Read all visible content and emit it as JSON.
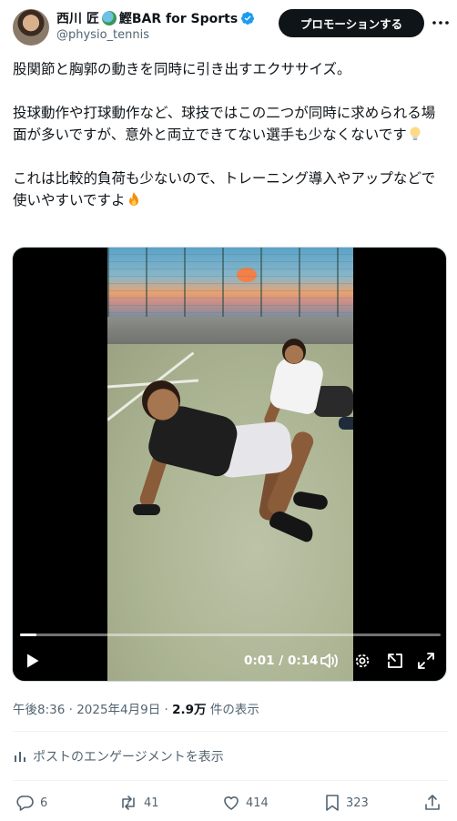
{
  "author": {
    "display_name": "西川 匠",
    "display_name_suffix": "鰹BAR for Sports",
    "handle": "@physio_tennis",
    "verified": true
  },
  "header": {
    "promote_label": "プロモーションする",
    "more_icon": "more-icon"
  },
  "tweet": {
    "paragraph1": "股関節と胸郭の動きを同時に引き出すエクササイズ。",
    "paragraph2": "投球動作や打球動作など、球技ではこの二つが同時に求められる場面が多いですが、意外と両立できてない選手も少なくないです",
    "paragraph3": "これは比較的負荷も少ないので、トレーニング導入やアップなどで使いやすいですよ",
    "emoji1": "lightbulb-icon",
    "emoji2": "fire-icon"
  },
  "video": {
    "current_time": "0:01",
    "separator": " / ",
    "duration": "0:14",
    "progress": 0.04
  },
  "meta": {
    "time": "午後8:36",
    "dot": " · ",
    "date": "2025年4月9日",
    "views": "2.9万",
    "views_label": " 件の表示"
  },
  "engagement_link": "ポストのエンゲージメントを表示",
  "actions": {
    "replies": "6",
    "retweets": "41",
    "likes": "414",
    "bookmarks": "323"
  },
  "colors": {
    "text_primary": "#0f1419",
    "text_secondary": "#536471",
    "verified_blue": "#1d9bf0"
  }
}
